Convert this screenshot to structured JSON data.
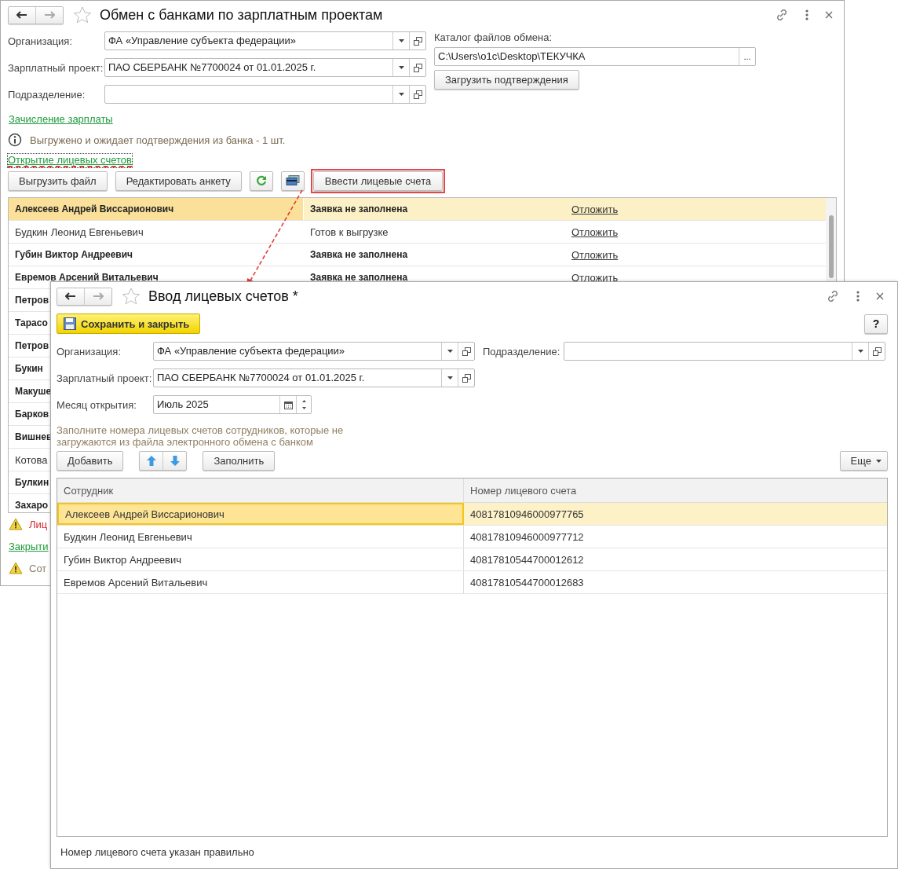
{
  "main_window": {
    "title": "Обмен с банками по зарплатным проектам",
    "fields": [
      {
        "label": "Организация:",
        "value": "ФА «Управление субъекта федерации»"
      },
      {
        "label": "Зарплатный проект:",
        "value": "ПАО СБЕРБАНК №7700024 от 01.01.2025 г."
      },
      {
        "label": "Подразделение:"
      }
    ],
    "catalog": {
      "label": "Каталог файлов обмена:",
      "value": "C:\\Users\\o1c\\Desktop\\ТЕКУЧКА",
      "button": "..."
    },
    "confirm_button": "Загрузить подтверждения",
    "payroll_link": "Зачисление зарплаты",
    "info_message": "Выгружено и ожидает подтверждения из банка - 1 шт.",
    "accounts_link": {
      "text": "Открытие лицевых счетов",
      "focused": true
    },
    "toolbar": [
      {
        "kind": "text",
        "label": "Выгрузить файл",
        "highlighted": false
      },
      {
        "kind": "text",
        "label": "Редактировать анкету",
        "highlighted": false
      },
      {
        "kind": "refresh",
        "highlighted": false
      },
      {
        "kind": "card",
        "highlighted": false
      },
      {
        "kind": "text",
        "label": "Ввести лицевые счета",
        "highlighted": true
      }
    ],
    "rows": [
      {
        "name": "Алексеев Андрей Виссарионович",
        "status": "Заявка не заполнена",
        "action": "Отложить",
        "bold": true,
        "selected": true
      },
      {
        "name": "Будкин Леонид Евгеньевич",
        "status": "Готов к выгрузке",
        "action": "Отложить",
        "bold": false,
        "selected": false
      },
      {
        "name": "Губин Виктор Андреевич",
        "status": "Заявка не заполнена",
        "action": "Отложить",
        "bold": true,
        "selected": false
      },
      {
        "name": "Евремов Арсений Витальевич",
        "status": "Заявка не заполнена",
        "action": "Отложить",
        "bold": true,
        "selected": false
      },
      {
        "name": "Петров",
        "bold": true,
        "selected": false
      },
      {
        "name": "Тарасо",
        "bold": true,
        "selected": false
      },
      {
        "name": "Петров",
        "bold": true,
        "selected": false
      },
      {
        "name": "Букин",
        "bold": true,
        "selected": false
      },
      {
        "name": "Макуше",
        "bold": true,
        "selected": false
      },
      {
        "name": "Барков",
        "bold": true,
        "selected": false
      },
      {
        "name": "Вишнев",
        "bold": true,
        "selected": false
      },
      {
        "name": "Котова",
        "bold": false,
        "selected": false
      },
      {
        "name": "Булкин",
        "bold": true,
        "selected": false
      },
      {
        "name": "Захаро",
        "bold": true,
        "selected": false
      }
    ],
    "messages": [
      {
        "kind": "error",
        "text": "Лиц"
      },
      {
        "kind": "link",
        "text": "Закрыти"
      },
      {
        "kind": "note",
        "text": "Сот"
      }
    ]
  },
  "dialog": {
    "title": "Ввод лицевых счетов *",
    "save_button": "Сохранить и закрыть",
    "help_button": "?",
    "organization": {
      "label": "Организация:",
      "value": "ФА «Управление субъекта федерации»"
    },
    "subdivision": {
      "label": "Подразделение:"
    },
    "project": {
      "label": "Зарплатный проект:",
      "value": "ПАО СБЕРБАНК №7700024 от 01.01.2025 г."
    },
    "month": {
      "label": "Месяц открытия:",
      "value": "Июль 2025"
    },
    "hint": "Заполните номера лицевых счетов сотрудников, которые не загружаются из файла электронного обмена с банком",
    "add_button": "Добавить",
    "fill_button": "Заполнить",
    "more_button": "Еще",
    "columns": [
      "Сотрудник",
      "Номер лицевого счета"
    ],
    "rows": [
      {
        "employee": "Алексеев Андрей Виссарионович",
        "account": "40817810946000977765",
        "selected": true
      },
      {
        "employee": "Будкин Леонид Евгеньевич",
        "account": "40817810946000977712",
        "selected": false
      },
      {
        "employee": "Губин Виктор Андреевич",
        "account": "40817810544700012612",
        "selected": false
      },
      {
        "employee": "Евремов Арсений Витальевич",
        "account": "40817810544700012683",
        "selected": false
      }
    ],
    "footer": "Номер лицевого счета указан правильно"
  }
}
